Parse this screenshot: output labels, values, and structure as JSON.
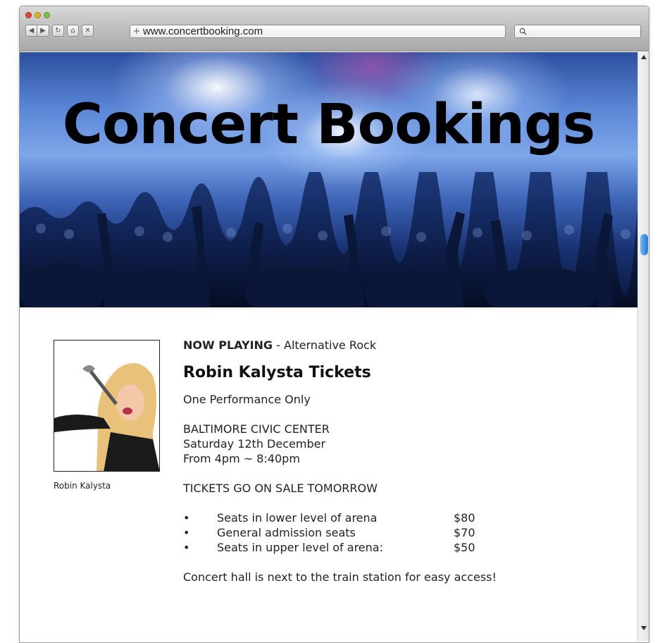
{
  "browser": {
    "url": "www.concertbooking.com",
    "back_icon": "back-arrow-icon",
    "forward_icon": "forward-arrow-icon",
    "reload_icon": "reload-icon",
    "home_icon": "home-icon",
    "stop_icon": "close-icon",
    "search_icon": "search-icon"
  },
  "hero": {
    "title": "Concert Bookings"
  },
  "artist": {
    "photo_caption": "Robin Kalysta"
  },
  "event": {
    "now_playing_label": "NOW PLAYING",
    "genre": " - Alternative Rock",
    "title": "Robin Kalysta Tickets",
    "subtitle": "One Performance Only",
    "venue": "BALTIMORE CIVIC CENTER",
    "date": "Saturday 12th December",
    "time": "From 4pm ~ 8:40pm",
    "sale_notice": "TICKETS GO ON SALE TOMORROW",
    "prices": [
      {
        "bullet": "•",
        "label": "Seats in lower level of arena",
        "price": "$80"
      },
      {
        "bullet": "•",
        "label": "General admission seats",
        "price": "$70"
      },
      {
        "bullet": "•",
        "label": "Seats in upper level of arena:",
        "price": "$50"
      }
    ],
    "footer_note": "Concert hall is next to the train station for easy access!"
  }
}
